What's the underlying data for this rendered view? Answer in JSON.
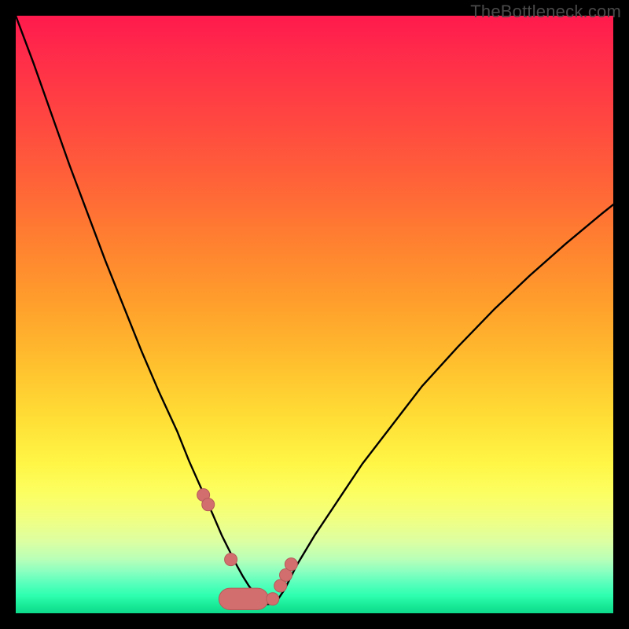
{
  "watermark": "TheBottleneck.com",
  "colors": {
    "curve": "#000000",
    "marker_fill": "#d36e6e",
    "marker_stroke": "#b55a5a",
    "band_fill": "#d36e6e"
  },
  "chart_data": {
    "type": "line",
    "title": "",
    "xlabel": "",
    "ylabel": "",
    "xlim": [
      0,
      100
    ],
    "ylim": [
      0,
      100
    ],
    "grid": false,
    "series": [
      {
        "name": "bottleneck-curve",
        "x": [
          0,
          3,
          6,
          9,
          12,
          15,
          18,
          21,
          24,
          27,
          29,
          31,
          33,
          34.5,
          36,
          37,
          38,
          39,
          40,
          41,
          42,
          43,
          44,
          45,
          47,
          50,
          54,
          58,
          63,
          68,
          74,
          80,
          86,
          92,
          98,
          100
        ],
        "y": [
          100,
          92,
          83.5,
          75,
          67,
          59,
          51.5,
          44,
          37,
          30.5,
          25.5,
          21,
          16.5,
          13,
          10,
          8,
          6.2,
          4.6,
          3.3,
          2.3,
          1.5,
          1.6,
          2.5,
          4,
          8,
          13,
          19,
          25,
          31.5,
          38,
          44.6,
          50.8,
          56.5,
          61.8,
          66.8,
          68.4
        ]
      }
    ],
    "markers": {
      "name": "highlight-points",
      "x": [
        31.4,
        32.2,
        36.0,
        43.0,
        44.3,
        45.2,
        46.1
      ],
      "y": [
        19.8,
        18.2,
        9.0,
        2.4,
        4.6,
        6.4,
        8.2
      ]
    },
    "band": {
      "name": "bottom-band",
      "x": [
        34.0,
        42.3
      ],
      "y_floor": 0.6,
      "height": 3.6
    }
  }
}
